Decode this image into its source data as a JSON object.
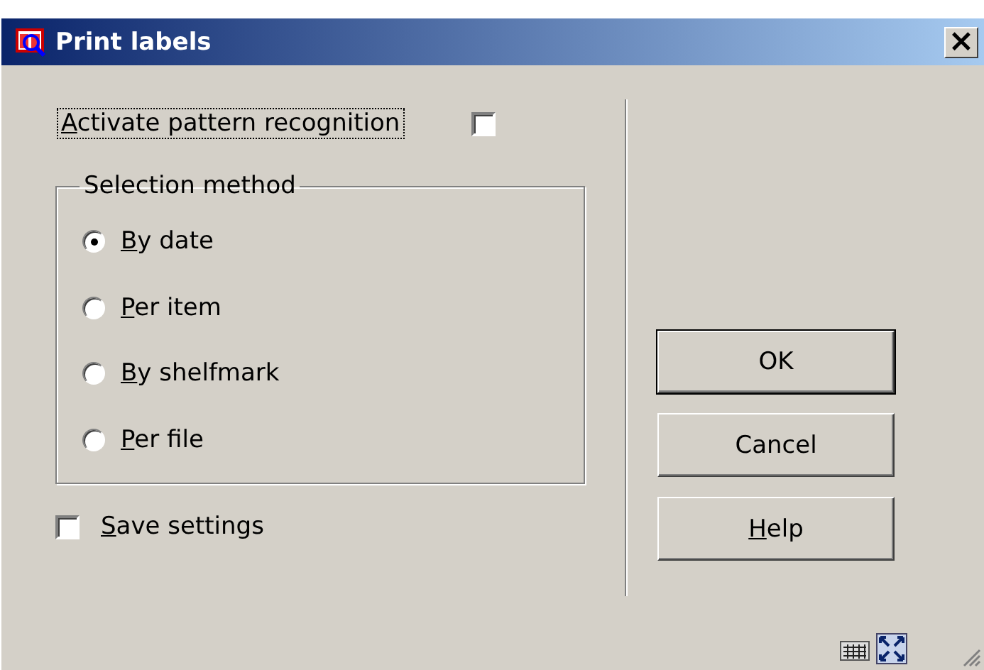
{
  "window": {
    "title": "Print labels",
    "close_glyph": "×"
  },
  "pattern_recognition": {
    "label": "Activate pattern recognition",
    "checked": false,
    "focused": true,
    "underline_first": true
  },
  "selection_method": {
    "title": "Selection method",
    "options": [
      {
        "label": "By date",
        "selected": true,
        "underline_first": true
      },
      {
        "label": "Per item",
        "selected": false,
        "underline_first": true
      },
      {
        "label": "By shelfmark",
        "selected": false,
        "underline_first": true
      },
      {
        "label": "Per file",
        "selected": false,
        "underline_first": true
      }
    ]
  },
  "save_settings": {
    "label": "Save settings",
    "checked": false,
    "underline_first": true
  },
  "buttons": [
    {
      "label": "OK",
      "default": true,
      "underline_first": false
    },
    {
      "label": "Cancel",
      "default": false,
      "underline_first": false
    },
    {
      "label": "Help",
      "default": false,
      "underline_first": true
    }
  ]
}
